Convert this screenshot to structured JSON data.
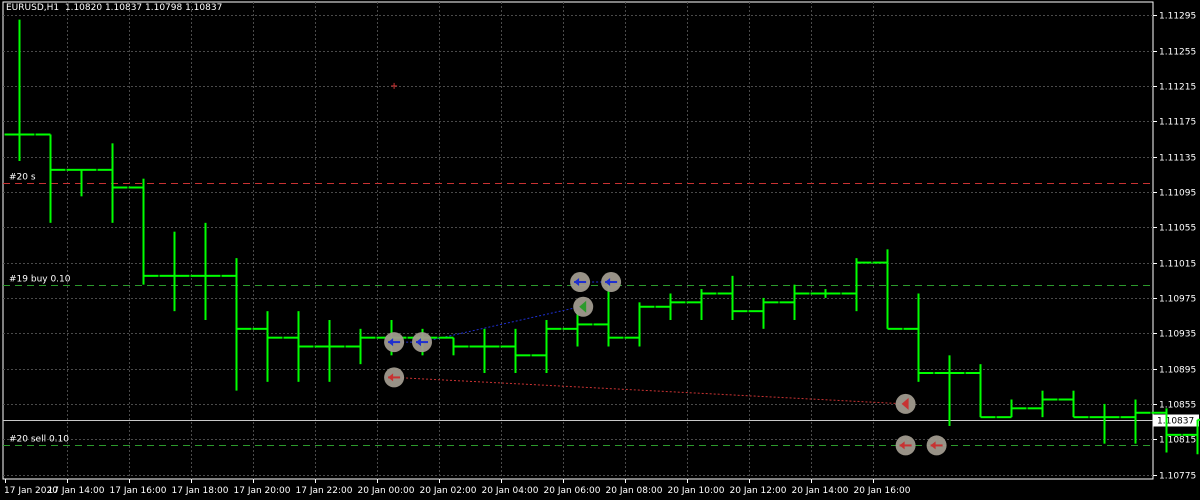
{
  "header": {
    "symbol": "EURUSD,H1",
    "ohlc": "1.10820 1.10837 1.10798 1.10837"
  },
  "chart_data": {
    "type": "ohlc",
    "timeframe": "H1",
    "ylim": [
      1.1077,
      1.1131
    ],
    "y_ticks": [
      "1.11295",
      "1.11255",
      "1.11215",
      "1.11175",
      "1.11135",
      "1.11095",
      "1.11055",
      "1.11015",
      "1.10975",
      "1.10935",
      "1.10895",
      "1.10855",
      "1.10815",
      "1.10775"
    ],
    "x_ticks": [
      "17 Jan 2020",
      "17 Jan 14:00",
      "17 Jan 16:00",
      "17 Jan 18:00",
      "17 Jan 20:00",
      "17 Jan 22:00",
      "20 Jan 00:00",
      "20 Jan 02:00",
      "20 Jan 04:00",
      "20 Jan 06:00",
      "20 Jan 08:00",
      "20 Jan 10:00",
      "20 Jan 12:00",
      "20 Jan 14:00",
      "20 Jan 16:00"
    ],
    "current_price": "1.10837",
    "bars": [
      {
        "o": 1.1116,
        "h": 1.1129,
        "l": 1.1113,
        "c": 1.1116
      },
      {
        "o": 1.1116,
        "h": 1.1116,
        "l": 1.1106,
        "c": 1.1112
      },
      {
        "o": 1.1112,
        "h": 1.1112,
        "l": 1.1109,
        "c": 1.1112
      },
      {
        "o": 1.1112,
        "h": 1.1115,
        "l": 1.1106,
        "c": 1.111
      },
      {
        "o": 1.111,
        "h": 1.1111,
        "l": 1.1099,
        "c": 1.11
      },
      {
        "o": 1.11,
        "h": 1.1105,
        "l": 1.1096,
        "c": 1.11
      },
      {
        "o": 1.11,
        "h": 1.1106,
        "l": 1.1095,
        "c": 1.11
      },
      {
        "o": 1.11,
        "h": 1.1102,
        "l": 1.1087,
        "c": 1.1094
      },
      {
        "o": 1.1094,
        "h": 1.1096,
        "l": 1.1088,
        "c": 1.1093
      },
      {
        "o": 1.1093,
        "h": 1.1096,
        "l": 1.1088,
        "c": 1.1092
      },
      {
        "o": 1.1092,
        "h": 1.1095,
        "l": 1.1088,
        "c": 1.1092
      },
      {
        "o": 1.1092,
        "h": 1.1094,
        "l": 1.109,
        "c": 1.1093
      },
      {
        "o": 1.1093,
        "h": 1.1095,
        "l": 1.1091,
        "c": 1.1093
      },
      {
        "o": 1.1093,
        "h": 1.1094,
        "l": 1.1091,
        "c": 1.1093
      },
      {
        "o": 1.1093,
        "h": 1.1093,
        "l": 1.1091,
        "c": 1.1092
      },
      {
        "o": 1.1092,
        "h": 1.1094,
        "l": 1.1089,
        "c": 1.1092
      },
      {
        "o": 1.1092,
        "h": 1.1094,
        "l": 1.1089,
        "c": 1.1091
      },
      {
        "o": 1.1091,
        "h": 1.1095,
        "l": 1.1089,
        "c": 1.1094
      },
      {
        "o": 1.1094,
        "h": 1.1096,
        "l": 1.1092,
        "c": 1.10945
      },
      {
        "o": 1.10945,
        "h": 1.1099,
        "l": 1.1092,
        "c": 1.1093
      },
      {
        "o": 1.1093,
        "h": 1.1097,
        "l": 1.1092,
        "c": 1.10965
      },
      {
        "o": 1.10965,
        "h": 1.1098,
        "l": 1.1095,
        "c": 1.1097
      },
      {
        "o": 1.1097,
        "h": 1.10985,
        "l": 1.1095,
        "c": 1.1098
      },
      {
        "o": 1.1098,
        "h": 1.11,
        "l": 1.1095,
        "c": 1.1096
      },
      {
        "o": 1.1096,
        "h": 1.10975,
        "l": 1.1094,
        "c": 1.1097
      },
      {
        "o": 1.1097,
        "h": 1.1099,
        "l": 1.1095,
        "c": 1.1098
      },
      {
        "o": 1.1098,
        "h": 1.10985,
        "l": 1.10975,
        "c": 1.1098
      },
      {
        "o": 1.1098,
        "h": 1.1102,
        "l": 1.1096,
        "c": 1.11015
      },
      {
        "o": 1.11015,
        "h": 1.1103,
        "l": 1.1094,
        "c": 1.1094
      },
      {
        "o": 1.1094,
        "h": 1.1098,
        "l": 1.1088,
        "c": 1.1089
      },
      {
        "o": 1.1089,
        "h": 1.1091,
        "l": 1.1083,
        "c": 1.1089
      },
      {
        "o": 1.1089,
        "h": 1.109,
        "l": 1.1084,
        "c": 1.1084
      },
      {
        "o": 1.1084,
        "h": 1.1086,
        "l": 1.1084,
        "c": 1.1085
      },
      {
        "o": 1.1085,
        "h": 1.1087,
        "l": 1.1084,
        "c": 1.1086
      },
      {
        "o": 1.1086,
        "h": 1.1087,
        "l": 1.1084,
        "c": 1.1084
      },
      {
        "o": 1.1084,
        "h": 1.10855,
        "l": 1.1081,
        "c": 1.1084
      },
      {
        "o": 1.1084,
        "h": 1.1086,
        "l": 1.1081,
        "c": 1.10845
      },
      {
        "o": 1.10845,
        "h": 1.1085,
        "l": 1.108,
        "c": 1.1082
      },
      {
        "o": 1.1082,
        "h": 1.10837,
        "l": 1.10798,
        "c": 1.10837
      }
    ],
    "levels": [
      {
        "label": "#20 s",
        "price": 1.11105,
        "color": "#c83232",
        "style": "dashed"
      },
      {
        "label": "#19 buy 0.10",
        "price": 1.1099,
        "color": "#2c9a2c",
        "style": "dashed"
      },
      {
        "label": "#20 sell 0.10",
        "price": 1.10808,
        "color": "#2c9a2c",
        "style": "dashed"
      }
    ],
    "trades": [
      {
        "from_bar": 12.1,
        "from_price": 1.10925,
        "to_bar": 13.0,
        "to_price": 1.10925,
        "color": "#1e2fd0"
      },
      {
        "from_bar": 18.1,
        "from_price": 1.10993,
        "to_bar": 19.1,
        "to_price": 1.10993,
        "color": "#1e2fd0"
      },
      {
        "from_bar": 13.0,
        "from_price": 1.10925,
        "to_bar": 18.1,
        "to_price": 1.10965,
        "color": "#1e2fd0"
      },
      {
        "from_bar": 12.1,
        "from_price": 1.10885,
        "to_bar": 28.6,
        "to_price": 1.10855,
        "color": "#c83232"
      }
    ],
    "markers": [
      {
        "bar": 12.1,
        "price": 1.10925,
        "kind": "arrow",
        "color": "#1e2fd0"
      },
      {
        "bar": 13.0,
        "price": 1.10925,
        "kind": "arrow",
        "color": "#1e2fd0"
      },
      {
        "bar": 18.1,
        "price": 1.10993,
        "kind": "arrow",
        "color": "#1e2fd0"
      },
      {
        "bar": 19.1,
        "price": 1.10993,
        "kind": "arrow",
        "color": "#1e2fd0"
      },
      {
        "bar": 18.2,
        "price": 1.10965,
        "kind": "close",
        "color": "#2c9a2c"
      },
      {
        "bar": 12.1,
        "price": 1.10885,
        "kind": "arrow",
        "color": "#c83232"
      },
      {
        "bar": 28.6,
        "price": 1.10855,
        "kind": "close",
        "color": "#c83232"
      },
      {
        "bar": 28.6,
        "price": 1.10808,
        "kind": "arrow",
        "color": "#c83232"
      },
      {
        "bar": 29.6,
        "price": 1.10808,
        "kind": "arrow",
        "color": "#c83232"
      }
    ],
    "stray_mark": {
      "bar": 12.1,
      "price": 1.11215
    },
    "colors": {
      "bar": "#00ff00",
      "grid": "#4a4a4a",
      "axis": "#ffffff",
      "text": "#ffffff"
    }
  }
}
